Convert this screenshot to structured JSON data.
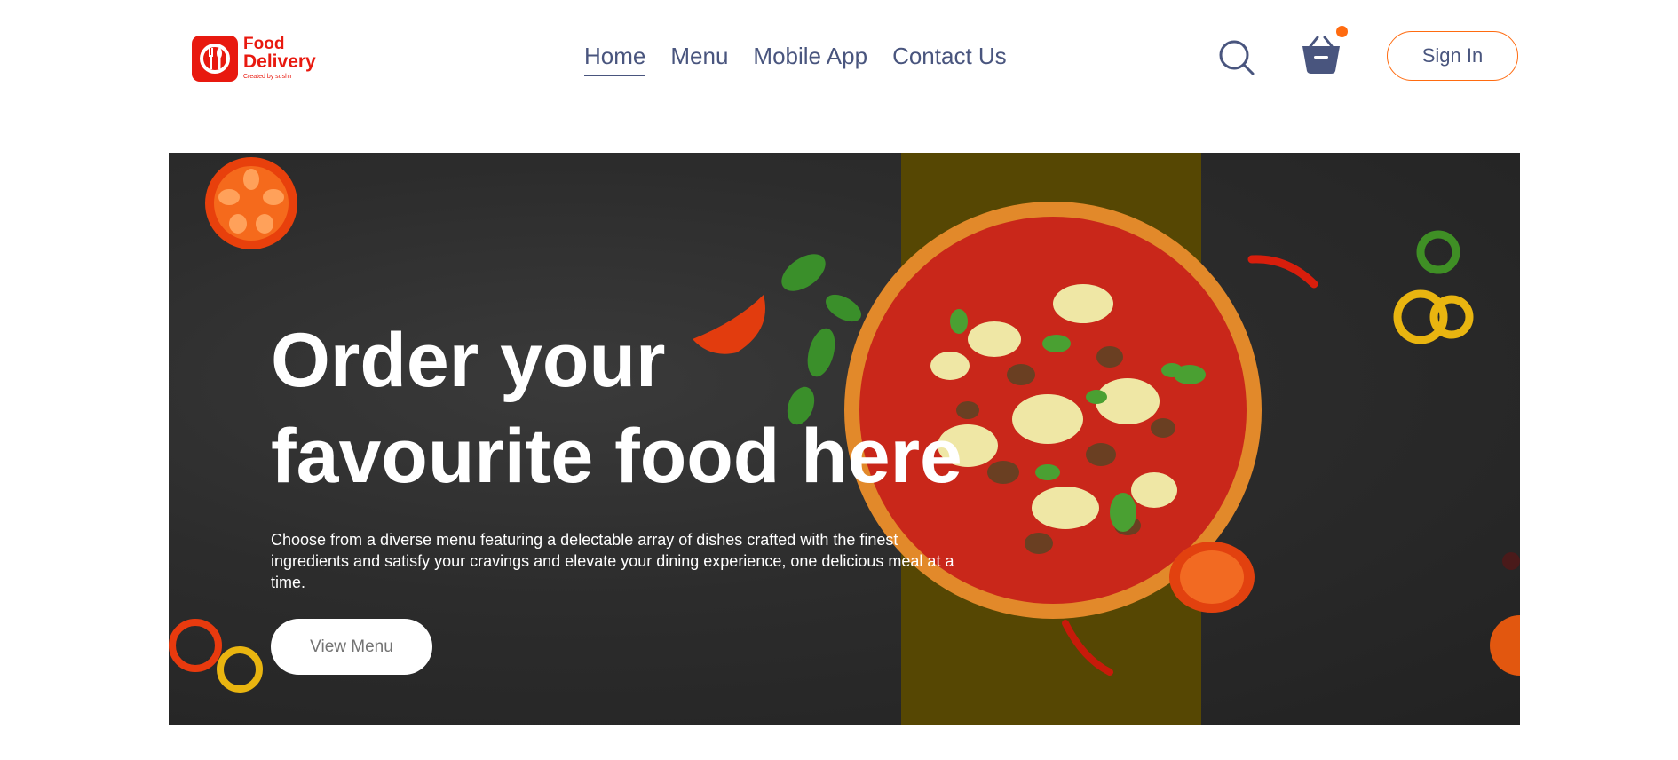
{
  "brand": {
    "line1": "Food",
    "line2": "Delivery",
    "tagline": "Created by sushir",
    "color": "#e8190f"
  },
  "nav": {
    "links": [
      {
        "label": "Home",
        "active": true
      },
      {
        "label": "Menu",
        "active": false
      },
      {
        "label": "Mobile App",
        "active": false
      },
      {
        "label": "Contact Us",
        "active": false
      }
    ],
    "search_icon": "search-icon",
    "basket_icon": "basket-icon",
    "cart_indicator_color": "#ff6b10",
    "signin_label": "Sign In",
    "accent": "#ff6b10",
    "text_color": "#49557e"
  },
  "hero": {
    "title_line1": "Order your",
    "title_line2": "favourite food here",
    "description": "Choose from a diverse menu featuring a delectable array of dishes crafted with the finest ingredients and satisfy your cravings and elevate your dining experience, one delicious meal at a time.",
    "cta_label": "View Menu"
  }
}
